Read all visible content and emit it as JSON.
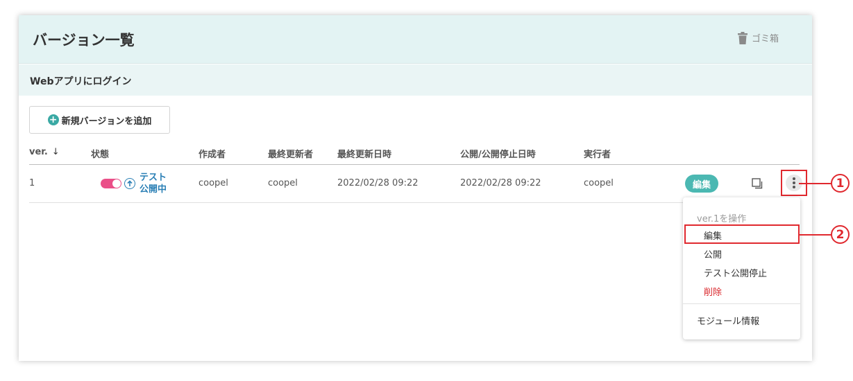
{
  "header": {
    "title": "バージョン一覧",
    "trash_label": "ゴミ箱"
  },
  "app": {
    "name": "Webアプリにログイン"
  },
  "toolbar": {
    "add_version_label": "新規バージョンを追加"
  },
  "table": {
    "columns": [
      "ver.",
      "状態",
      "作成者",
      "最終更新者",
      "最終更新日時",
      "公開/公開停止日時",
      "実行者"
    ],
    "rows": [
      {
        "ver": "1",
        "status_line1": "テスト",
        "status_line2": "公開中",
        "toggle_on": true,
        "creator": "coopel",
        "updater": "coopel",
        "updated_at": "2022/02/28 09:22",
        "published_at": "2022/02/28 09:22",
        "executor": "coopel",
        "edit_label": "編集"
      }
    ]
  },
  "menu": {
    "heading": "ver.1を操作",
    "items": [
      "編集",
      "公開",
      "テスト公開停止",
      "削除"
    ],
    "module_info": "モジュール情報"
  },
  "callouts": [
    "1",
    "2"
  ],
  "colors": {
    "accent": "#4bb8b2",
    "toggle": "#ea4f88",
    "link": "#2a7fb5",
    "danger": "#d9262b",
    "highlight": "#e0282e"
  }
}
